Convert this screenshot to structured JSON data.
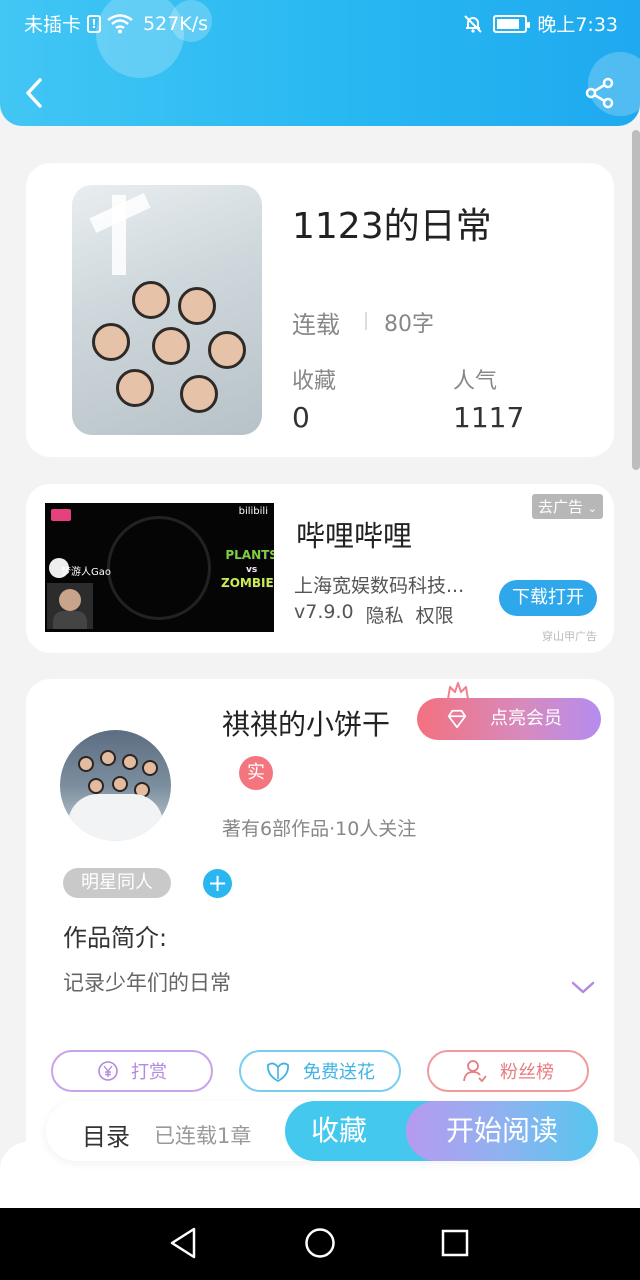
{
  "status_bar": {
    "carrier": "未插卡",
    "speed": "527K/s",
    "time": "晚上7:33",
    "icons": [
      "sim-alert-icon",
      "wifi-icon",
      "mute-bell-icon",
      "battery-icon"
    ]
  },
  "header": {
    "back_icon": "chevron-left-icon",
    "share_icon": "share-icon",
    "gradient": [
      "#42c6f4",
      "#1fa9ef"
    ]
  },
  "book": {
    "title": "1123的日常",
    "status": "连载",
    "word_count": "80字",
    "favorites_label": "收藏",
    "favorites_value": "0",
    "popularity_label": "人气",
    "popularity_value": "1117"
  },
  "ad": {
    "title": "哔哩哔哩",
    "company": "上海宽娱数码科技...",
    "version": "v7.9.0",
    "privacy": "隐私",
    "permissions": "权限",
    "close_label": "去广告",
    "download_label": "下载打开",
    "source": "穿山甲广告",
    "thumb_logo": "bilibili",
    "thumb_game_line1": "PLANTS",
    "thumb_game_vs": "vs",
    "thumb_game_line2": "ZOMBIES",
    "thumb_player": "梦游人Gao"
  },
  "author": {
    "name": "祺祺的小饼干",
    "vip_label": "点亮会员",
    "verified_badge": "实",
    "stats": "著有6部作品·10人关注",
    "genre_tag": "明星同人",
    "add_tag": "+",
    "intro_heading": "作品简介:",
    "intro_text": "记录少年们的日常"
  },
  "actions": {
    "tip_label": "打赏",
    "tip_icon": "yen-circle-icon",
    "flower_label": "免费送花",
    "flower_icon": "flower-icon",
    "fans_label": "粉丝榜",
    "fans_icon": "fans-user-icon"
  },
  "bottom_bar": {
    "toc_label": "目录",
    "chapters_label": "已连载1章",
    "favorite_label": "收藏",
    "read_label": "开始阅读"
  },
  "colors": {
    "primary_blue": "#2ab6ef",
    "vip_pink": "#f3717f",
    "vip_purple": "#b48cf0"
  }
}
